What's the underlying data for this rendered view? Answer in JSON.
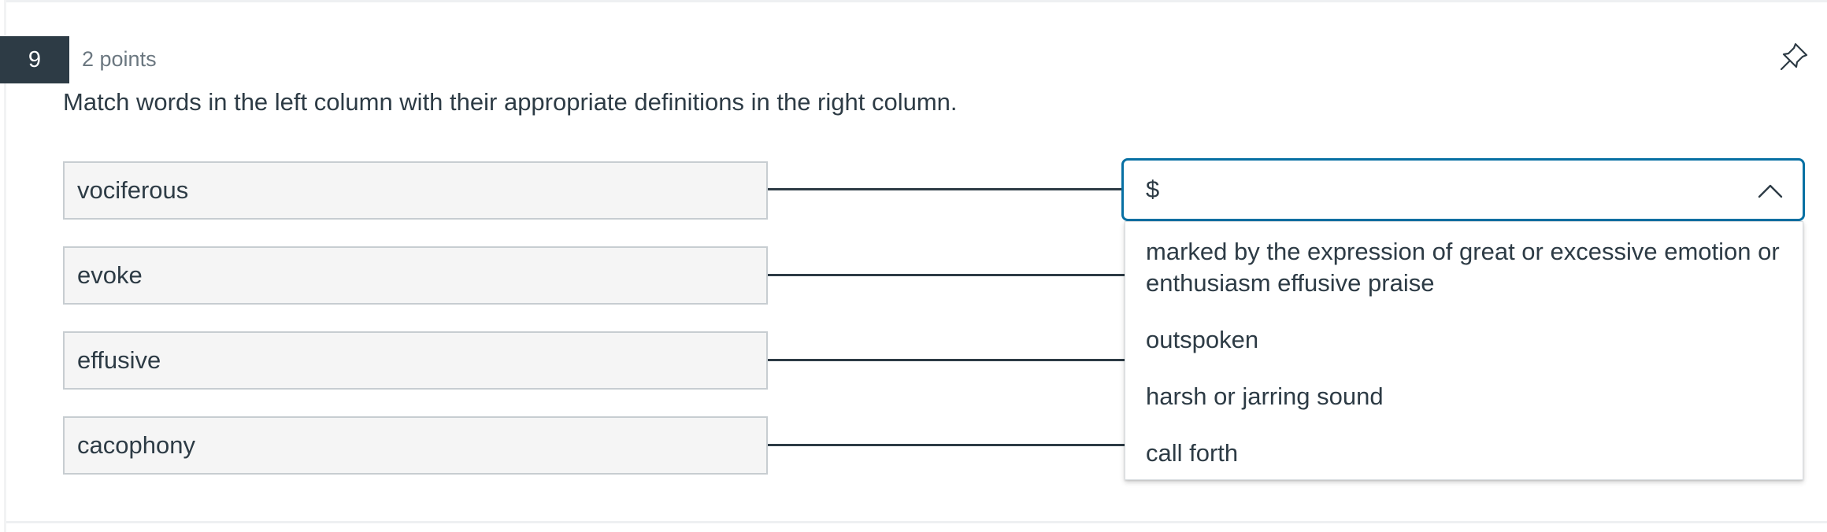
{
  "question": {
    "number": "9",
    "points": "2 points",
    "text": "Match words in the left column with their appropriate definitions in the right column."
  },
  "icons": {
    "pin": "pin-icon",
    "chevron": "chevron-up-icon"
  },
  "words": [
    {
      "label": "vociferous"
    },
    {
      "label": "evoke"
    },
    {
      "label": "effusive"
    },
    {
      "label": "cacophony"
    }
  ],
  "select": {
    "current_value": "$",
    "expanded": true,
    "options": [
      {
        "label": "marked by the expression of great or excessive emotion or enthusiasm effusive praise"
      },
      {
        "label": "outspoken"
      },
      {
        "label": "harsh or jarring sound"
      },
      {
        "label": "call forth"
      }
    ]
  },
  "colors": {
    "accent": "#0770a3",
    "dark": "#2d3b45",
    "muted": "#6b7780",
    "word_bg": "#f5f5f5"
  }
}
